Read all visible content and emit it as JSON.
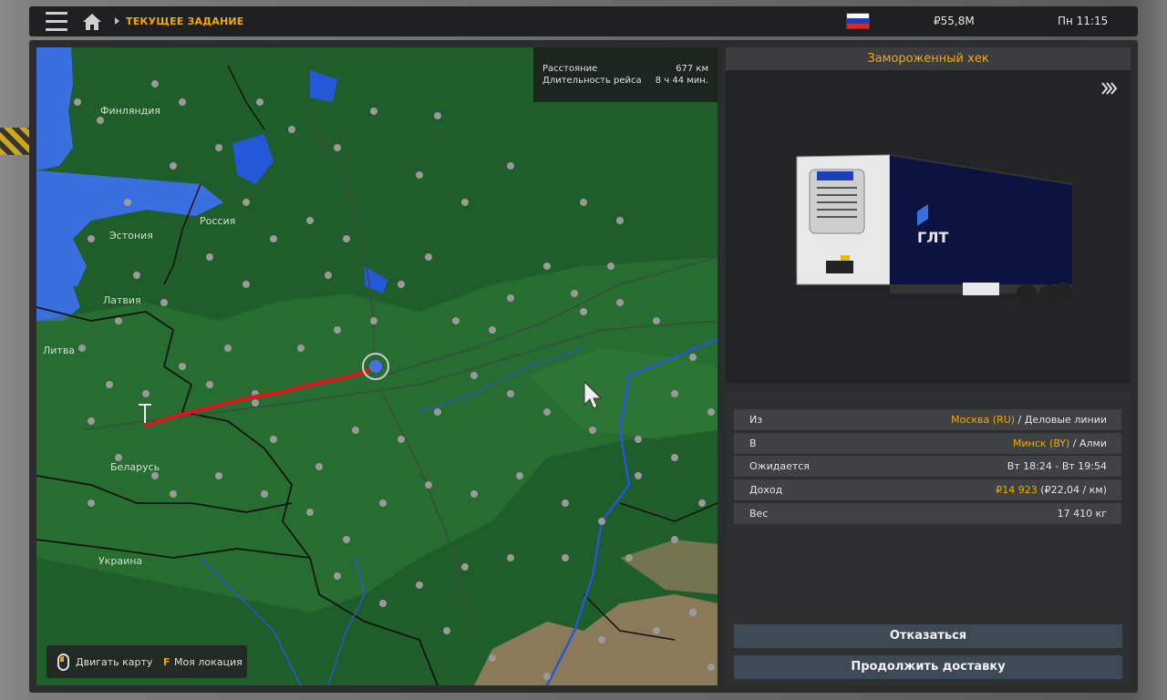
{
  "header": {
    "breadcrumb": "ТЕКУЩЕЕ ЗАДАНИЕ",
    "money": "₽55,8M",
    "clock": "Пн 11:15",
    "flag_colors": [
      "#ffffff",
      "#1c3fb8",
      "#d52b1e"
    ]
  },
  "map": {
    "route_info": {
      "distance_label": "Расстояние",
      "distance_value": "677 км",
      "duration_label": "Длительность рейса",
      "duration_value": "8 ч 44 мин."
    },
    "labels": {
      "finland": "Финляндия",
      "russia": "Россия",
      "estonia": "Эстония",
      "latvia": "Латвия",
      "lithuania": "Литва",
      "belarus": "Беларусь",
      "ukraine": "Украина"
    },
    "hint": {
      "move_map": "Двигать карту",
      "key": "F",
      "my_location": "Моя локация"
    },
    "colors": {
      "land": "#1f5e2a",
      "water": "#3a6fe0",
      "route": "#e0141c"
    }
  },
  "cargo": {
    "title": "Замороженный хек"
  },
  "details": {
    "from_label": "Из",
    "from_city": "Москва (RU)",
    "from_company": " / Деловые линии",
    "to_label": "В",
    "to_city": "Минск (BY)",
    "to_company": " / Алми",
    "expected_label": "Ожидается",
    "expected_value": "Вт 18:24 - Вт 19:54",
    "income_label": "Доход",
    "income_value": "₽14 923",
    "income_rate": " (₽22,04 / км)",
    "weight_label": "Вес",
    "weight_value": "17 410 кг"
  },
  "actions": {
    "decline": "Отказаться",
    "continue": "Продолжить доставку"
  },
  "accent_color": "#f2a900"
}
